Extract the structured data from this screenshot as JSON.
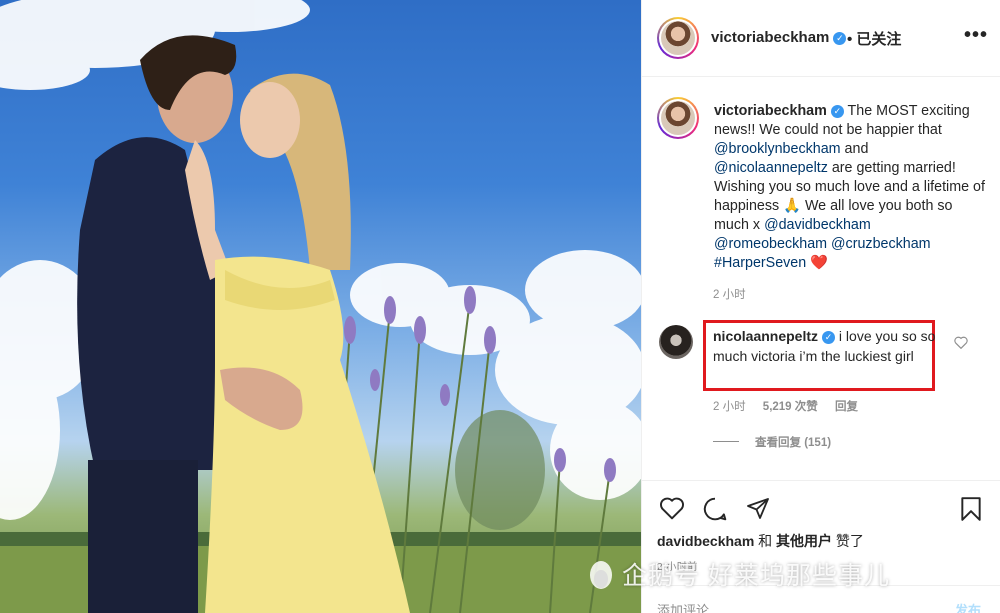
{
  "header": {
    "username": "victoriabeckham",
    "follow_status": "• 已关注",
    "more": "•••"
  },
  "caption": {
    "username": "victoriabeckham",
    "text_1": " The MOST exciting news!! We could not be happier that ",
    "mention_1": "@brooklynbeckham",
    "text_2": " and ",
    "mention_2": "@nicolaannepeltz",
    "text_3": " are getting married! Wishing you so much love and a lifetime of happiness ",
    "emoji_1": "🙏",
    "text_4": " We all love you both so much x ",
    "mention_3": "@davidbeckham",
    "mention_4": "@romeobeckham",
    "mention_5": "@cruzbeckham",
    "hashtag": "#HarperSeven",
    "emoji_2": "❤️",
    "time": "2 小时"
  },
  "comment": {
    "username": "nicolaannepeltz",
    "text": " i love you so so much victoria i’m the luckiest girl",
    "time": "2 小时",
    "likes": "5,219 次赞",
    "reply": "回复",
    "view_replies": "查看回复 (151)"
  },
  "likes": {
    "user": "davidbeckham",
    "conj": " 和 ",
    "others": "其他用户",
    "suffix": " 赞了"
  },
  "post_time": "2 小时前",
  "add_comment": {
    "placeholder": "添加评论...",
    "post_label": "发布"
  },
  "watermark": "企鹅号 好莱坞那些事儿",
  "colors": {
    "highlight_box": "#e0191e",
    "link": "#00376b",
    "verified": "#3897f0",
    "muted": "#8e8e8e"
  }
}
